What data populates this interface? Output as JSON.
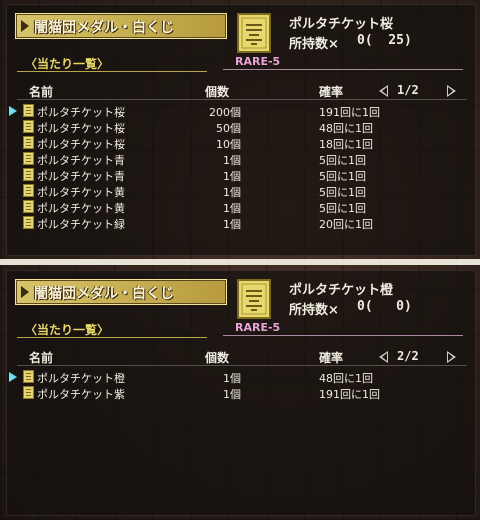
{
  "panels": [
    {
      "title": "闇猫団メダル・白くじ",
      "item_name": "ポルタチケット桜",
      "owned_label": "所持数×",
      "owned_value": "0(  25)",
      "rarity": "RARE-5",
      "list_title": "〈当たり一覧〉",
      "headers": {
        "name": "名前",
        "count": "個数",
        "rate": "確率"
      },
      "page": "1/2",
      "rows": [
        {
          "name": "ポルタチケット桜",
          "count": "200個",
          "rate": "191回に1回"
        },
        {
          "name": "ポルタチケット桜",
          "count": "50個",
          "rate": "48回に1回"
        },
        {
          "name": "ポルタチケット桜",
          "count": "10個",
          "rate": "18回に1回"
        },
        {
          "name": "ポルタチケット青",
          "count": "1個",
          "rate": "5回に1回"
        },
        {
          "name": "ポルタチケット青",
          "count": "1個",
          "rate": "5回に1回"
        },
        {
          "name": "ポルタチケット黄",
          "count": "1個",
          "rate": "5回に1回"
        },
        {
          "name": "ポルタチケット黄",
          "count": "1個",
          "rate": "5回に1回"
        },
        {
          "name": "ポルタチケット緑",
          "count": "1個",
          "rate": "20回に1回"
        }
      ]
    },
    {
      "title": "闇猫団メダル・白くじ",
      "item_name": "ポルタチケット橙",
      "owned_label": "所持数×",
      "owned_value": "0(   0)",
      "rarity": "RARE-5",
      "list_title": "〈当たり一覧〉",
      "headers": {
        "name": "名前",
        "count": "個数",
        "rate": "確率"
      },
      "page": "2/2",
      "rows": [
        {
          "name": "ポルタチケット橙",
          "count": "1個",
          "rate": "48回に1回"
        },
        {
          "name": "ポルタチケット紫",
          "count": "1個",
          "rate": "191回に1回"
        }
      ]
    }
  ],
  "colors": {
    "title_gold": "#d8c46a",
    "rarity_pink": "#e8a3d8",
    "cursor_cyan": "#6ee0f0",
    "list_title_yellow": "#e8d86a"
  },
  "icons": {
    "ticket": "ticket-icon",
    "cursor": "cursor-arrow-icon",
    "page_prev": "triangle-left-icon",
    "page_next": "triangle-right-icon"
  }
}
